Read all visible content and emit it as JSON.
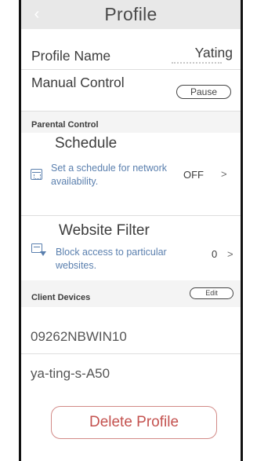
{
  "header": {
    "title": "Profile"
  },
  "profile": {
    "name_label": "Profile Name",
    "name_value": "Yating"
  },
  "manual_control": {
    "label": "Manual Control",
    "button_label": "Pause"
  },
  "parental_control": {
    "section_title": "Parental Control",
    "schedule": {
      "title": "Schedule",
      "description": "Set a schedule for network availability.",
      "status": "OFF",
      "icon": "calendar-icon"
    },
    "website_filter": {
      "title": "Website Filter",
      "description": "Block access to particular websites.",
      "count": "0",
      "icon": "website-filter-icon"
    }
  },
  "client_devices": {
    "section_title": "Client Devices",
    "edit_label": "Edit",
    "devices": [
      "09262NBWIN10",
      "ya-ting-s-A50"
    ]
  },
  "delete": {
    "label": "Delete Profile"
  },
  "colors": {
    "accent_blue": "#5a7fae",
    "delete_red": "#c4524f",
    "header_gray": "#e8e8e8"
  }
}
